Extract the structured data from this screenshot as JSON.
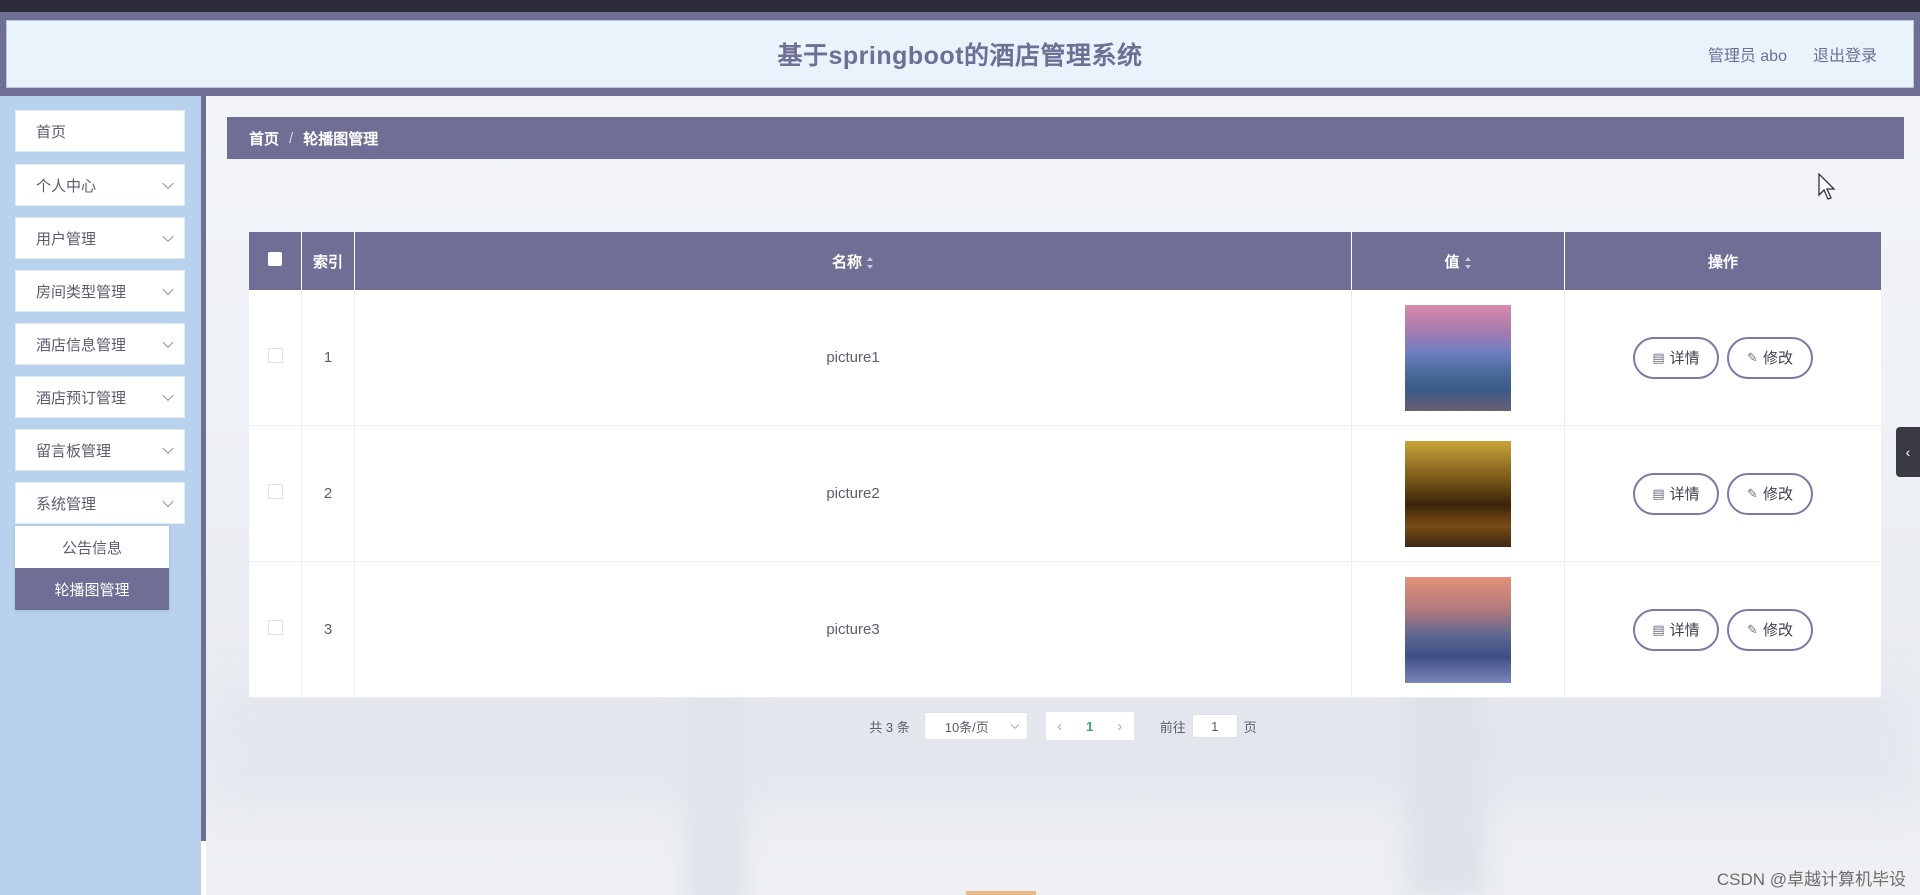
{
  "header": {
    "title": "基于springboot的酒店管理系统",
    "user_label": "管理员 abo",
    "logout_label": "退出登录"
  },
  "sidebar": {
    "items": [
      {
        "label": "首页"
      },
      {
        "label": "个人中心"
      },
      {
        "label": "用户管理"
      },
      {
        "label": "房间类型管理"
      },
      {
        "label": "酒店信息管理"
      },
      {
        "label": "酒店预订管理"
      },
      {
        "label": "留言板管理"
      },
      {
        "label": "系统管理"
      }
    ],
    "submenu": [
      {
        "label": "公告信息"
      },
      {
        "label": "轮播图管理"
      }
    ]
  },
  "breadcrumb": {
    "home": "首页",
    "separator": "/",
    "current": "轮播图管理"
  },
  "table": {
    "headers": {
      "index": "索引",
      "name": "名称",
      "value": "值",
      "actions": "操作"
    },
    "rows": [
      {
        "index": "1",
        "name": "picture1"
      },
      {
        "index": "2",
        "name": "picture2"
      },
      {
        "index": "3",
        "name": "picture3"
      }
    ],
    "detail_label": "详情",
    "edit_label": "修改"
  },
  "pagination": {
    "total": "共 3 条",
    "page_size": "10条/页",
    "current_page": "1",
    "goto_label": "前往",
    "goto_value": "1",
    "page_suffix": "页"
  },
  "watermark": "CSDN @卓越计算机毕设",
  "colors": {
    "primary": "#6f6e95",
    "sidebar_bg": "#b8d2ee",
    "header_bg": "#e8f3fc"
  }
}
